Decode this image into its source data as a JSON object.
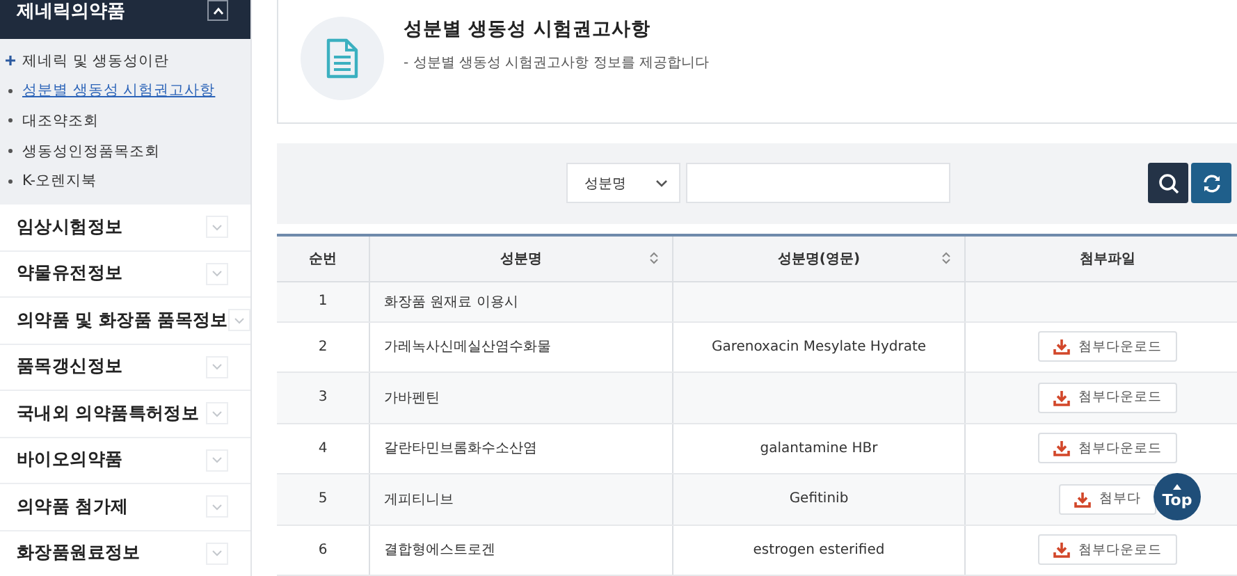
{
  "sidebar": {
    "header": {
      "label": "제네릭의약품",
      "expanded": true
    },
    "subitems": [
      {
        "label": "제네릭 및 생동성이란",
        "kind": "plus",
        "selected": false
      },
      {
        "label": "성분별 생동성 시험권고사항",
        "kind": "dot",
        "selected": true
      },
      {
        "label": "대조약조회",
        "kind": "dot",
        "selected": false
      },
      {
        "label": "생동성인정품목조회",
        "kind": "dot",
        "selected": false
      },
      {
        "label": "K-오렌지북",
        "kind": "dot",
        "selected": false
      }
    ],
    "menus": [
      {
        "label": "임상시험정보",
        "expanded": false
      },
      {
        "label": "약물유전정보",
        "expanded": false
      },
      {
        "label": "의약품 및 화장품 품목정보",
        "expanded": false
      },
      {
        "label": "품목갱신정보",
        "expanded": false
      },
      {
        "label": "국내외 의약품특허정보",
        "expanded": false
      },
      {
        "label": "바이오의약품",
        "expanded": false
      },
      {
        "label": "의약품 첨가제",
        "expanded": false
      },
      {
        "label": "화장품원료정보",
        "expanded": false
      }
    ]
  },
  "page_header": {
    "title": "성분별 생동성 시험권고사항",
    "description": "-  성분별 생동성 시험권고사항 정보를 제공합니다"
  },
  "search": {
    "select": "성분명"
  },
  "table": {
    "columns": [
      {
        "label": "순번",
        "sortable": false
      },
      {
        "label": "성분명",
        "sortable": true
      },
      {
        "label": "성분명(영문)",
        "sortable": true
      },
      {
        "label": "첨부파일",
        "sortable": false
      }
    ],
    "rows": [
      {
        "no": "1",
        "name": "화장품 원재료 이용시"
      },
      {
        "no": "2",
        "name": "가레녹사신메실산염수화물",
        "name_en": "Garenoxacin Mesylate Hydrate",
        "download": "첨부다운로드"
      },
      {
        "no": "3",
        "name": "가바펜틴",
        "download": "첨부다운로드"
      },
      {
        "no": "4",
        "name": "갈란타민브롬화수소산염",
        "name_en": "galantamine HBr",
        "download": "첨부다운로드"
      },
      {
        "no": "5",
        "name": "게피티니브",
        "name_en": "Gefitinib",
        "download": "첨부다"
      },
      {
        "no": "6",
        "name": "결합형에스트로겐",
        "name_en": "estrogen esterified",
        "download": "첨부다운로드"
      }
    ]
  },
  "top_button": {
    "label": "Top"
  }
}
